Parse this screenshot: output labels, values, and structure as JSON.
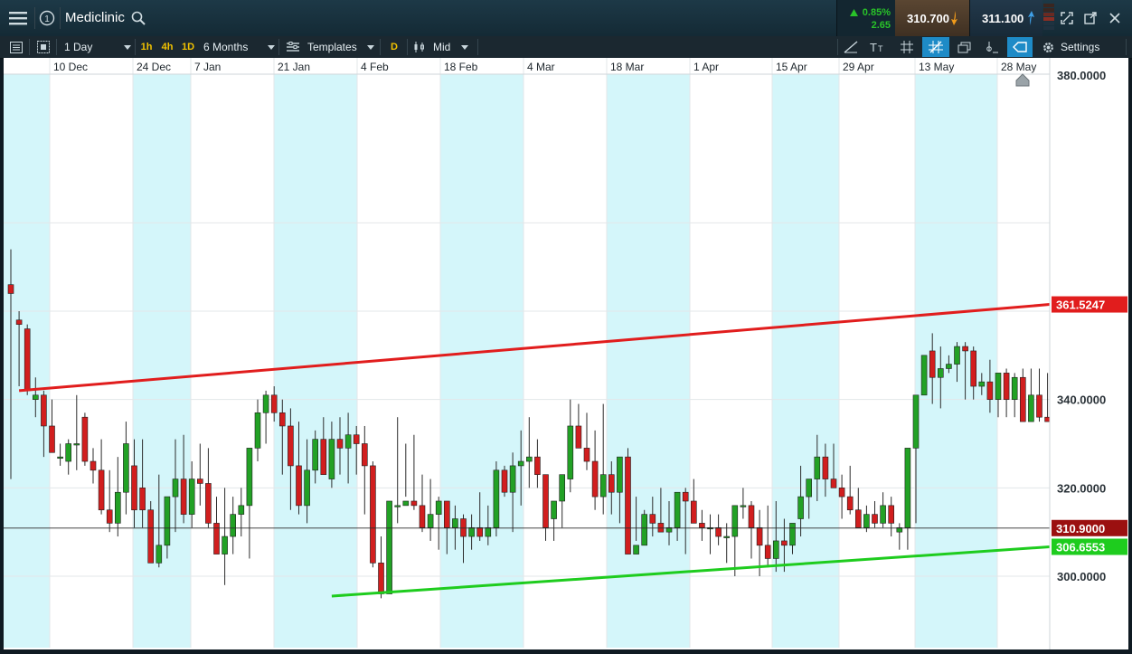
{
  "header": {
    "instrument": "Mediclinic",
    "change_percent": "0.85%",
    "change_points": "2.65",
    "sell_price": "310.700",
    "buy_price": "311.100"
  },
  "toolbar": {
    "interval": "1 Day",
    "timeframes": [
      "1h",
      "4h",
      "1D"
    ],
    "range": "6 Months",
    "templates": "Templates",
    "d_marker": "D",
    "price_type": "Mid",
    "settings": "Settings"
  },
  "icons": [
    "menu-icon",
    "info-icon",
    "search-icon",
    "caret-down-icon",
    "up-arrow-icon",
    "down-arrow-icon",
    "maximize-icon",
    "popout-icon",
    "close-icon",
    "list-icon",
    "grid-icon",
    "templates-icon",
    "candlestick-icon",
    "draw-line-icon",
    "text-icon",
    "gridlines-icon",
    "crosshair-icon",
    "layers-icon",
    "indicator-icon",
    "tag-icon",
    "gear-icon",
    "home-marker-icon"
  ],
  "colors": {
    "up": "#22a125",
    "down": "#d11e1e",
    "resistance_line": "#e11d1d",
    "support_line": "#1ecc1e",
    "current_price_tag": "#9b1010",
    "highlight_band": "#d4f6fa",
    "up_arrow": "#29c229",
    "sell_bg": "#4b3a2a",
    "accent": "#f5c400",
    "buy_arrow": "#3fa0e8"
  },
  "chart_data": {
    "type": "candlestick",
    "instrument": "Mediclinic",
    "interval": "1 Day",
    "range": "6 Months",
    "x_labels": [
      "10 Dec",
      "24 Dec",
      "7 Jan",
      "21 Jan",
      "4 Feb",
      "18 Feb",
      "4 Mar",
      "18 Mar",
      "1 Apr",
      "15 Apr",
      "29 Apr",
      "13 May",
      "28 May"
    ],
    "y_ticks": [
      "300.0000",
      "320.0000",
      "340.0000",
      "380.0000"
    ],
    "ylim": [
      293.5,
      380
    ],
    "current_price": 310.9,
    "current_price_label": "310.9000",
    "resistance_label": "361.5247",
    "support_label": "306.6553",
    "trendlines": [
      {
        "name": "resistance",
        "start_index": 1,
        "start": 342.0,
        "end_index": 125,
        "end": 361.5247
      },
      {
        "name": "support",
        "start_index": 39,
        "start": 295.5,
        "end_index": 125,
        "end": 306.6553
      }
    ],
    "ohlc": [
      [
        366,
        374,
        322,
        364
      ],
      [
        358,
        360,
        343,
        357
      ],
      [
        356,
        357,
        341,
        342
      ],
      [
        340,
        345,
        336,
        341
      ],
      [
        341,
        342,
        327,
        334
      ],
      [
        334,
        340,
        329,
        328
      ],
      [
        327,
        330,
        325,
        327
      ],
      [
        326,
        331,
        323,
        330
      ],
      [
        330,
        341,
        324,
        330
      ],
      [
        336,
        337,
        325,
        326
      ],
      [
        326,
        329,
        321,
        324
      ],
      [
        324,
        331,
        314,
        315
      ],
      [
        315,
        324,
        310,
        312
      ],
      [
        312,
        327,
        309,
        319
      ],
      [
        319,
        335,
        314,
        330
      ],
      [
        325,
        331,
        311,
        315
      ],
      [
        320,
        331,
        311,
        315
      ],
      [
        315,
        317,
        305,
        303
      ],
      [
        303,
        323,
        302,
        307
      ],
      [
        307,
        314,
        304,
        318
      ],
      [
        318,
        331,
        310,
        322
      ],
      [
        322,
        332,
        312,
        314
      ],
      [
        314,
        326,
        311,
        322
      ],
      [
        322,
        330,
        316,
        321
      ],
      [
        321,
        329,
        311,
        312
      ],
      [
        312,
        318,
        308,
        305
      ],
      [
        305,
        320,
        298,
        309
      ],
      [
        309,
        318,
        305,
        314
      ],
      [
        314,
        320,
        309,
        316
      ],
      [
        316,
        326,
        304,
        329
      ],
      [
        329,
        340,
        326,
        337
      ],
      [
        337,
        342,
        330,
        341
      ],
      [
        341,
        343,
        335,
        337
      ],
      [
        337,
        340,
        323,
        334
      ],
      [
        334,
        338,
        315,
        325
      ],
      [
        325,
        335,
        314,
        316
      ],
      [
        316,
        331,
        312,
        324
      ],
      [
        324,
        333,
        321,
        331
      ],
      [
        331,
        336,
        325,
        323
      ],
      [
        322,
        335,
        320,
        331
      ],
      [
        331,
        336,
        323,
        329
      ],
      [
        329,
        337,
        321,
        332
      ],
      [
        332,
        334,
        323,
        330
      ],
      [
        330,
        334,
        314,
        325
      ],
      [
        325,
        326,
        302,
        303
      ],
      [
        303,
        309,
        295,
        296
      ],
      [
        296,
        317,
        298,
        317
      ],
      [
        316,
        336,
        312,
        316
      ],
      [
        316,
        330,
        318,
        317
      ],
      [
        317,
        332,
        315,
        316
      ],
      [
        316,
        323,
        310,
        311
      ],
      [
        311,
        322,
        308,
        314
      ],
      [
        314,
        318,
        306,
        317
      ],
      [
        317,
        317,
        305,
        311
      ],
      [
        311,
        316,
        306,
        313
      ],
      [
        313,
        314,
        303,
        309
      ],
      [
        309,
        314,
        306,
        311
      ],
      [
        311,
        319,
        308,
        309
      ],
      [
        309,
        316,
        307,
        311
      ],
      [
        311,
        326,
        309,
        324
      ],
      [
        324,
        325,
        318,
        319
      ],
      [
        319,
        328,
        310,
        325
      ],
      [
        325,
        333,
        316,
        326
      ],
      [
        326,
        336,
        320,
        327
      ],
      [
        327,
        331,
        320,
        323
      ],
      [
        323,
        323,
        308,
        311
      ],
      [
        313,
        314,
        308,
        317
      ],
      [
        317,
        322,
        311,
        323
      ],
      [
        322,
        340,
        319,
        334
      ],
      [
        334,
        339,
        329,
        329
      ],
      [
        329,
        337,
        324,
        326
      ],
      [
        326,
        333,
        315,
        318
      ],
      [
        318,
        339,
        314,
        323
      ],
      [
        323,
        326,
        314,
        319
      ],
      [
        319,
        325,
        312,
        327
      ],
      [
        327,
        329,
        307,
        305
      ],
      [
        305,
        318,
        308,
        307
      ],
      [
        307,
        315,
        310,
        314
      ],
      [
        314,
        318,
        309,
        312
      ],
      [
        312,
        320,
        311,
        310
      ],
      [
        310,
        317,
        307,
        311
      ],
      [
        311,
        318,
        308,
        319
      ],
      [
        319,
        320,
        305,
        317
      ],
      [
        317,
        322,
        315,
        312
      ],
      [
        312,
        315,
        308,
        311
      ],
      [
        311,
        314,
        305,
        311
      ],
      [
        311,
        314,
        307,
        309
      ],
      [
        309,
        312,
        303,
        309
      ],
      [
        309,
        316,
        300,
        316
      ],
      [
        316,
        320,
        313,
        316
      ],
      [
        316,
        317,
        304,
        311
      ],
      [
        311,
        315,
        300,
        307
      ],
      [
        307,
        316,
        302,
        304
      ],
      [
        304,
        317,
        301,
        308
      ],
      [
        308,
        313,
        301,
        307
      ],
      [
        307,
        311,
        305,
        312
      ],
      [
        313,
        325,
        309,
        318
      ],
      [
        318,
        320,
        313,
        322
      ],
      [
        322,
        332,
        317,
        327
      ],
      [
        327,
        330,
        318,
        322
      ],
      [
        322,
        330,
        320,
        320
      ],
      [
        320,
        323,
        313,
        318
      ],
      [
        318,
        325,
        314,
        315
      ],
      [
        315,
        320,
        312,
        311
      ],
      [
        311,
        316,
        310,
        314
      ],
      [
        314,
        317,
        311,
        312
      ],
      [
        312,
        319,
        311,
        316
      ],
      [
        316,
        318,
        309,
        312
      ],
      [
        310,
        312,
        306,
        311
      ],
      [
        311,
        313,
        306,
        329
      ],
      [
        329,
        341,
        312,
        341
      ],
      [
        341,
        350,
        341,
        350
      ],
      [
        351,
        355,
        339,
        345
      ],
      [
        345,
        352,
        338,
        347
      ],
      [
        347,
        350,
        346,
        348
      ],
      [
        348,
        353,
        344,
        352
      ],
      [
        352,
        353,
        340,
        351
      ],
      [
        351,
        352,
        340,
        343
      ],
      [
        343,
        346,
        341,
        344
      ],
      [
        344,
        349,
        337,
        340
      ],
      [
        340,
        345,
        336,
        346
      ],
      [
        346,
        347,
        336,
        340
      ],
      [
        340,
        346,
        336,
        345
      ],
      [
        345,
        347,
        336,
        335
      ],
      [
        335,
        347,
        337,
        341
      ],
      [
        341,
        347,
        335,
        336
      ],
      [
        336,
        346,
        336,
        335
      ],
      [
        335,
        344,
        334,
        336
      ]
    ]
  }
}
